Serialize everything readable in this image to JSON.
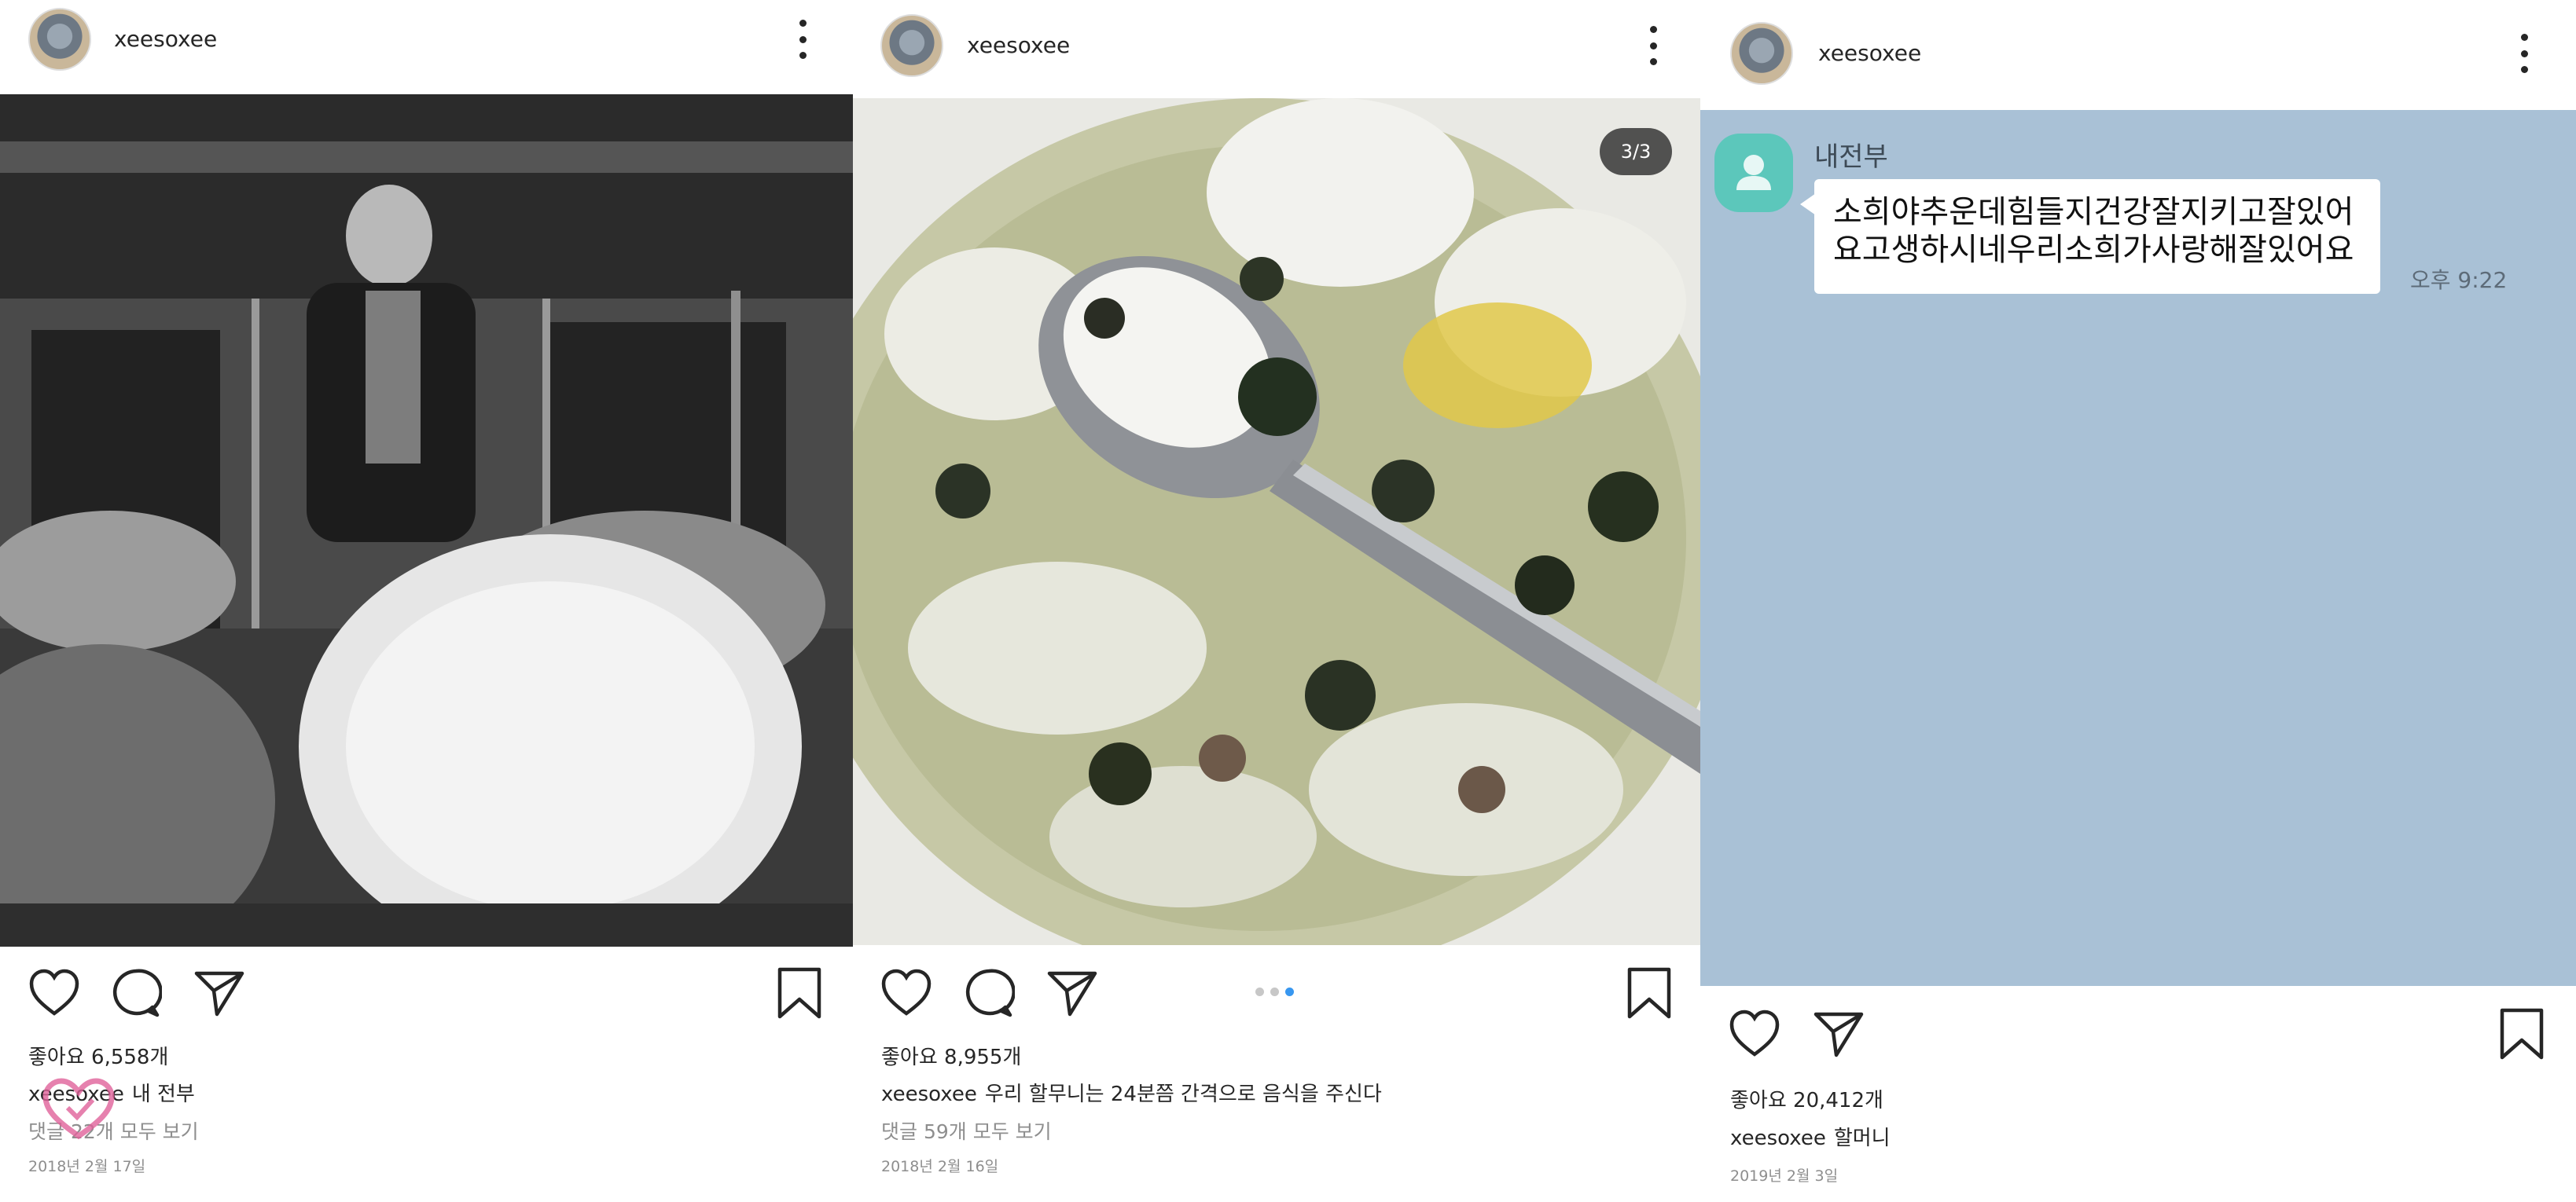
{
  "posts": [
    {
      "username": "xeesoxee",
      "likes": "좋아요 6,558개",
      "caption_user": "xeesoxee",
      "caption_text": "내 전부",
      "comments": "댓글 22개 모두 보기",
      "date": "2018년 2월 17일",
      "icons": [
        "heart-icon",
        "comment-icon",
        "send-icon",
        "bookmark-icon",
        "more-icon"
      ]
    },
    {
      "username": "xeesoxee",
      "counter": "3/3",
      "carousel": {
        "total": 3,
        "active": 3
      },
      "likes": "좋아요 8,955개",
      "caption_user": "xeesoxee",
      "caption_text": "우리 할무니는 24분쯤 간격으로 음식을 주신다",
      "comments": "댓글 59개 모두 보기",
      "date": "2018년 2월 16일",
      "icons": [
        "heart-icon",
        "comment-icon",
        "send-icon",
        "bookmark-icon",
        "more-icon"
      ]
    },
    {
      "username": "xeesoxee",
      "chat": {
        "sender": "내전부",
        "message_lines": [
          "소희야추운데힘들지건강잘지키고잘있어",
          "요고생하시네우리소희가사랑해잘있어요"
        ],
        "time": "오후 9:22",
        "background_color": "#a9c1d6",
        "avatar_color": "#5cc7bb"
      },
      "likes": "좋아요 20,412개",
      "caption_user": "xeesoxee",
      "caption_text": "할머니",
      "date": "2019년 2월 3일",
      "icons": [
        "heart-icon",
        "send-icon",
        "bookmark-icon",
        "more-icon"
      ]
    }
  ],
  "colors": {
    "text": "#262626",
    "muted": "#8e8e8e",
    "carousel_active": "#3897f0",
    "watermark": "#e0629a"
  }
}
